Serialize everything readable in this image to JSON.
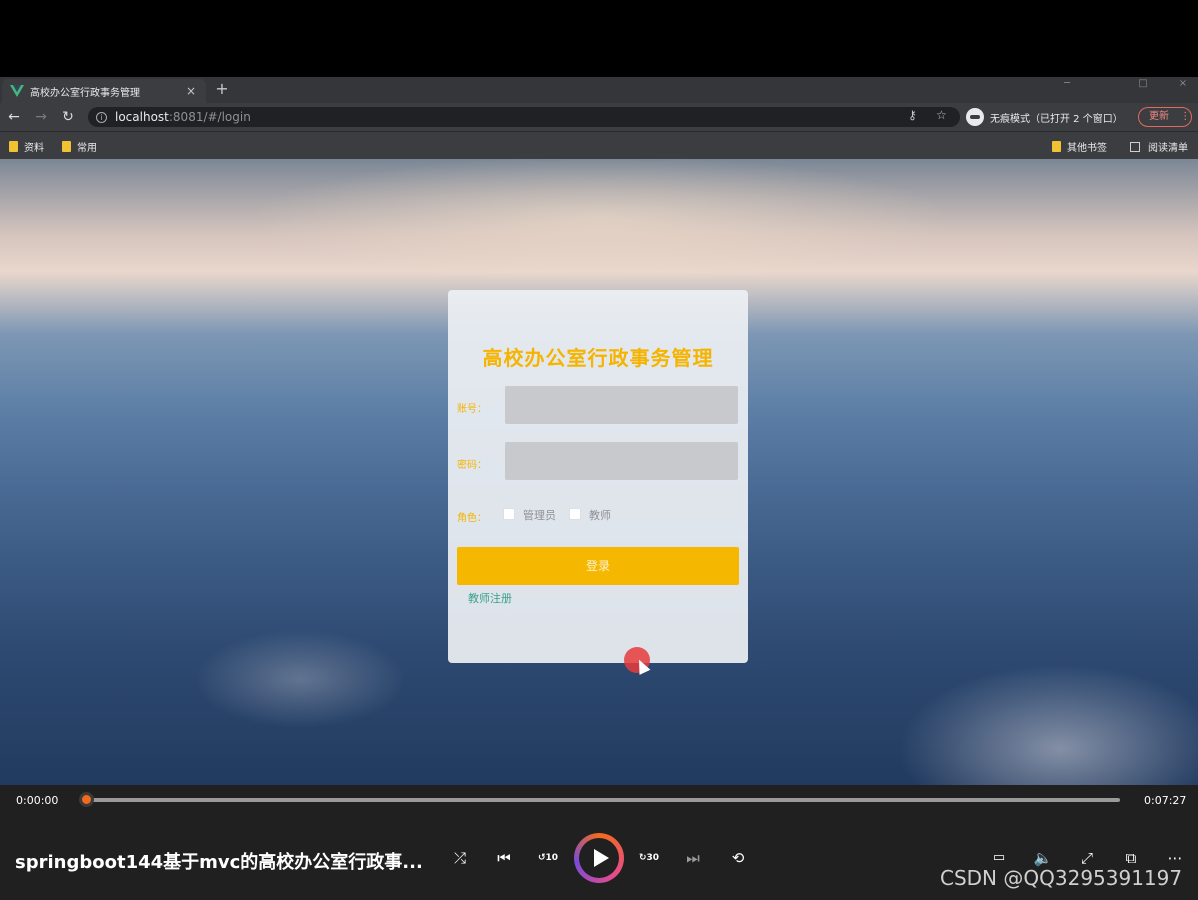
{
  "browser": {
    "tab_title": "高校办公室行政事务管理",
    "tab_close": "×",
    "new_tab": "+",
    "url_host": "localhost",
    "url_path": ":8081/#/login",
    "incognito_text": "无痕模式（已打开 2 个窗口）",
    "update_label": "更新",
    "menu_glyph": "⋮",
    "window_controls": [
      "─",
      "□",
      "×"
    ]
  },
  "bookmarks": {
    "left": [
      "资料",
      "常用"
    ],
    "other": "其他书签",
    "reading_list": "阅读清单"
  },
  "login": {
    "title": "高校办公室行政事务管理",
    "account_label": "账号：",
    "password_label": "密码：",
    "role_label": "角色：",
    "role_options": [
      "管理员",
      "教师"
    ],
    "login_button": "登录",
    "register_link": "教师注册"
  },
  "player": {
    "current_time": "0:00:00",
    "total_time": "0:07:27",
    "progress": 0.0,
    "video_title": "springboot144基于mvc的高校办公室行政事...",
    "skip_back_label": "10",
    "skip_forward_label": "30"
  },
  "watermark": "CSDN @QQ3295391197",
  "colors": {
    "accent": "#f5b700",
    "link": "#3aa08c",
    "seek_thumb": "#f26b1d"
  }
}
